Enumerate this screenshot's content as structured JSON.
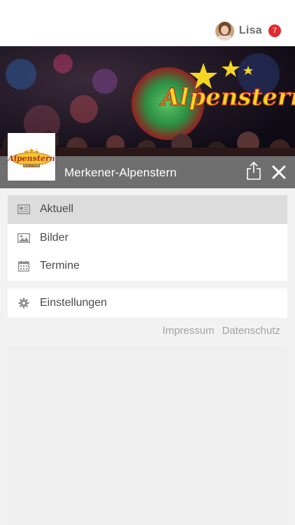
{
  "user": {
    "name": "Lisa",
    "notifications": "7"
  },
  "hero": {
    "banner_text": "Alpenstern",
    "title": "Merkener-Alpenstern",
    "logo_text": "Alpenstern",
    "logo_subtext": "DISCOTHEK"
  },
  "menu": {
    "items": [
      {
        "label": "Aktuell",
        "icon": "newspaper-icon",
        "active": true
      },
      {
        "label": "Bilder",
        "icon": "image-icon",
        "active": false
      },
      {
        "label": "Termine",
        "icon": "calendar-icon",
        "active": false
      }
    ],
    "settings": {
      "label": "Einstellungen",
      "icon": "gear-icon"
    }
  },
  "footer": {
    "impressum": "Impressum",
    "datenschutz": "Datenschutz"
  },
  "colors": {
    "badge": "#e4282e",
    "title_bar": "#696969",
    "active_item": "#dcdcdc",
    "banner_text": "#f5d521"
  }
}
